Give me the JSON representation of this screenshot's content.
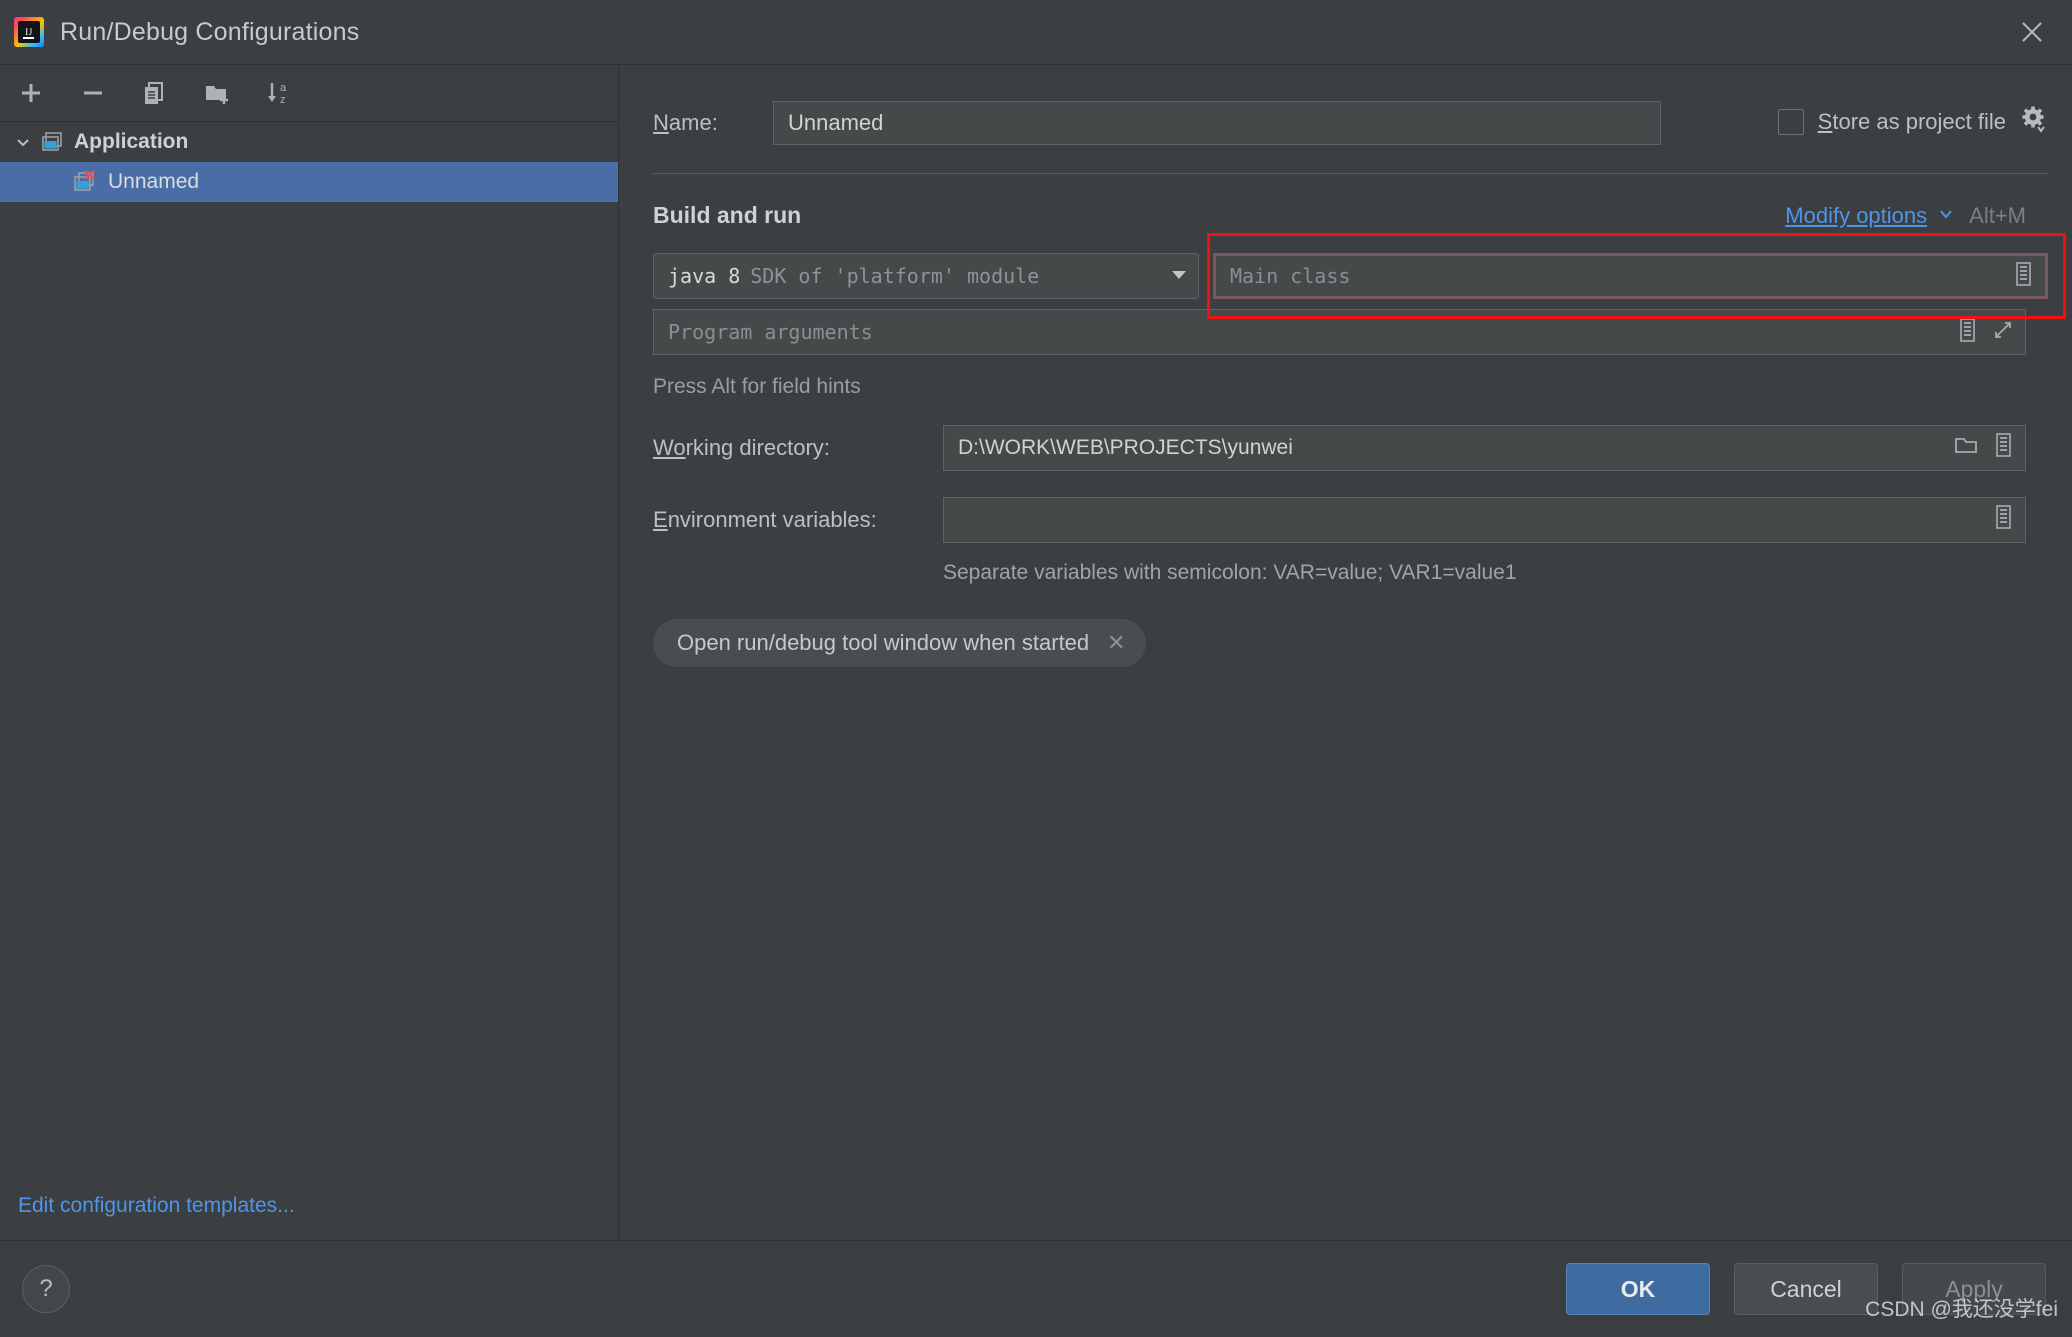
{
  "window": {
    "title": "Run/Debug Configurations",
    "logo_icon": "intellij-idea-logo",
    "close_icon": "close-icon"
  },
  "left_panel": {
    "toolbar": [
      {
        "name": "add-configuration",
        "icon": "plus-icon",
        "label": "+"
      },
      {
        "name": "remove-configuration",
        "icon": "minus-icon",
        "label": "−"
      },
      {
        "name": "copy-configuration",
        "icon": "copy-icon",
        "label": ""
      },
      {
        "name": "new-folder",
        "icon": "folder-add-icon",
        "label": ""
      },
      {
        "name": "sort-configurations",
        "icon": "sort-az-icon",
        "label": ""
      }
    ],
    "tree": [
      {
        "label": "Application",
        "type": "group",
        "expanded": true,
        "icon": "application-window-icon"
      },
      {
        "label": "Unnamed",
        "type": "child",
        "selected": true,
        "icon": "configuration-error-icon"
      }
    ],
    "edit_templates_link": "Edit configuration templates..."
  },
  "form": {
    "name_label": "Name:",
    "name_label_mnemonic": "N",
    "name_value": "Unnamed",
    "store_as_project_file": {
      "label": "Store as project file",
      "mnemonic": "S",
      "checked": false,
      "gear_icon": "gear-dropdown-icon"
    },
    "section": {
      "title": "Build and run",
      "modify_options": "Modify options",
      "modify_options_mnemonic": "M",
      "modify_shortcut": "Alt+M"
    },
    "sdk_combo": {
      "main": "java 8",
      "sub": "SDK of 'platform' module",
      "arrow_icon": "chevron-down-icon"
    },
    "main_class": {
      "placeholder": "Main class",
      "value": "",
      "has_error": true,
      "browse_icon": "list-icon"
    },
    "program_arguments": {
      "placeholder": "Program arguments",
      "value": "",
      "list_icon": "list-icon",
      "expand_icon": "expand-icon"
    },
    "field_hint": "Press Alt for field hints",
    "working_directory": {
      "label": "Working directory:",
      "mnemonic": "Wo",
      "value": "D:\\WORK\\WEB\\PROJECTS\\yunwei",
      "folder_icon": "folder-icon",
      "list_icon": "list-icon"
    },
    "environment_variables": {
      "label": "Environment variables:",
      "mnemonic": "E",
      "value": "",
      "list_icon": "list-icon"
    },
    "env_hint": "Separate variables with semicolon: VAR=value; VAR1=value1",
    "chip": {
      "label": "Open run/debug tool window when started",
      "close_icon": "chip-close-icon"
    }
  },
  "footer": {
    "help_label": "?",
    "ok_label": "OK",
    "cancel_label": "Cancel",
    "apply_label": "Apply",
    "watermark": "CSDN @我还没学fei"
  },
  "colors": {
    "background": "#3c3f41",
    "selection": "#4a6da7",
    "link": "#4f94e8",
    "error_highlight": "#f41010",
    "default_button": "#3f6ca0"
  }
}
